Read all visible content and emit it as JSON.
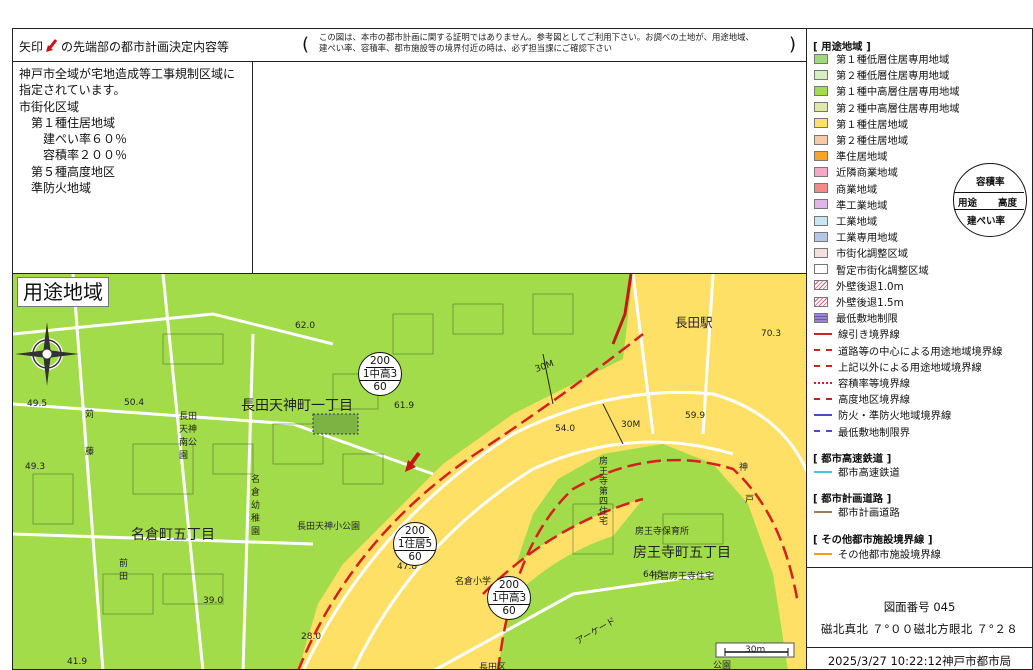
{
  "header": {
    "title_prefix": "矢印",
    "title_suffix": "の先端部の都市計画決定内容等",
    "note_line1": "この図は、本市の都市計画に関する証明ではありません。参考図としてご利用下さい。お調べの土地が、用途地域、",
    "note_line2": "建ぺい率、容積率、都市施設等の境界付近の時は、必ず担当課にご確認下さい",
    "paren_open": "(",
    "paren_close": ")"
  },
  "info": {
    "lines": [
      "神戸市全域が宅地造成等工事規制区域に",
      "指定されています。",
      "市街化区域",
      "　第１種住居地域",
      "　　建ぺい率６０％",
      "　　容積率２００％",
      "　第５種高度地区",
      "　準防火地域"
    ]
  },
  "map": {
    "title": "用途地域",
    "labels": {
      "tenjin1": "長田天神町一丁目",
      "nagura5": "名倉町五丁目",
      "bonoji5": "房王寺町五丁目",
      "nagata_station": "長田駅",
      "nagata_tenjin_park": "長田天神南公園",
      "nagata_tenjin_school": "長田天神小公園",
      "nagura_kinder": "名倉幼稚園",
      "bonoji_nursery": "房王寺保育所",
      "bonoji_housing": "市営房王寺住宅",
      "nagura_school": "名倉小学",
      "maeda": "前田",
      "kumo": "公園",
      "bonoji_apartments": "房王寺第四住宅",
      "nagatamonami": "長田区",
      "sujin": "苅",
      "fuku": "藤",
      "arcade": "アーケード",
      "jin": "神",
      "to": "戸",
      "dist_30m_a": "30M",
      "dist_30m_b": "30M",
      "scale": "30m"
    },
    "elevations": [
      "62.0",
      "70.3",
      "49.5",
      "50.4",
      "61.9",
      "59.9",
      "54.0",
      "49.3",
      "39.0",
      "28.0",
      "41.9",
      "47.8",
      "64.5"
    ],
    "zone_circles": [
      {
        "cap": "200",
        "mid": "1中高3",
        "bot": "60"
      },
      {
        "cap": "200",
        "mid": "1住居5",
        "bot": "60"
      },
      {
        "cap": "200",
        "mid": "1中高3",
        "bot": "60"
      }
    ]
  },
  "legend": {
    "h1": "[ 用途地域 ]",
    "zones": [
      {
        "label": "第１種低層住居専用地域",
        "color": "#9fd97d"
      },
      {
        "label": "第２種低層住居専用地域",
        "color": "#d6efc0"
      },
      {
        "label": "第１種中高層住居専用地域",
        "color": "#a3dc4a"
      },
      {
        "label": "第２種中高層住居専用地域",
        "color": "#dfe8a8"
      },
      {
        "label": "第１種住居地域",
        "color": "#ffe066"
      },
      {
        "label": "第２種住居地域",
        "color": "#f7c9a6"
      },
      {
        "label": "準住居地域",
        "color": "#f6a623"
      },
      {
        "label": "近隣商業地域",
        "color": "#f4a8c4"
      },
      {
        "label": "商業地域",
        "color": "#f28a8a"
      },
      {
        "label": "準工業地域",
        "color": "#e0b6e6"
      },
      {
        "label": "工業地域",
        "color": "#c7e6f2"
      },
      {
        "label": "工業専用地域",
        "color": "#b7c6e8"
      },
      {
        "label": "市街化調整区域",
        "color": "#f5dede"
      },
      {
        "label": "暫定市街化調整区域",
        "color": "#ffffff"
      },
      {
        "label": "外壁後退1.0m",
        "color": "#ffffff"
      },
      {
        "label": "外壁後退1.5m",
        "color": "#ffffff"
      },
      {
        "label": "最低敷地制限",
        "color": "#9b86c9"
      }
    ],
    "lines": [
      {
        "label": "線引き境界線",
        "color": "#d61f1f",
        "style": "solid"
      },
      {
        "label": "道路等の中心による用途地域境界線",
        "color": "#d61f1f",
        "style": "dashed"
      },
      {
        "label": "上記以外による用途地域境界線",
        "color": "#d61f1f",
        "style": "dashdot"
      },
      {
        "label": "容積率等境界線",
        "color": "#d61f1f",
        "style": "dotted"
      },
      {
        "label": "高度地区境界線",
        "color": "#b8261f",
        "style": "dashdotdot"
      },
      {
        "label": "防火・準防火地域境界線",
        "color": "#4a4ad0",
        "style": "solid"
      },
      {
        "label": "最低敷地制限界",
        "color": "#4a4ad0",
        "style": "dashed"
      }
    ],
    "h2": "[ 都市高速鉄道 ]",
    "rail": {
      "label": "都市高速鉄道",
      "color": "#3ec9d6"
    },
    "h3": "[ 都市計画道路 ]",
    "road": {
      "label": "都市計画道路",
      "color": "#a07a5a"
    },
    "h4": "[ その他都市施設境界線 ]",
    "other": {
      "label": "その他都市施設境界線",
      "color": "#f39a1f"
    },
    "key": {
      "top": "容積率",
      "left": "用途",
      "right": "高度",
      "bottom": "建ぺい率"
    }
  },
  "footer": {
    "map_number": "図面番号 045",
    "magnetic": "磁北真北 ７°００磁北方眼北 ７°２８",
    "stamp": "2025/3/27 10:22:12神戸市都市局"
  },
  "colors": {
    "zone_green": "#a3dc4a",
    "zone_yellow": "#ffe066",
    "boundary_red": "#d61f1f"
  }
}
